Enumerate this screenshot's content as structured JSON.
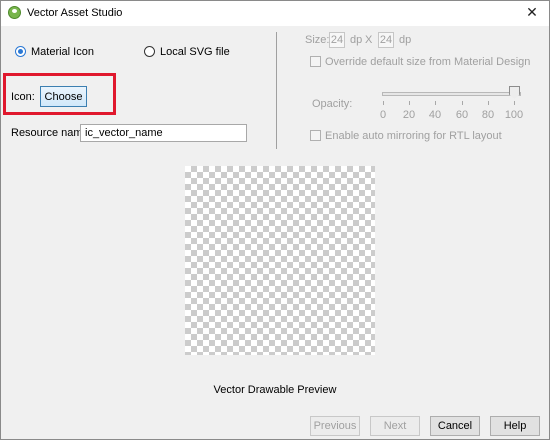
{
  "window": {
    "title": "Vector Asset Studio",
    "close_glyph": "✕",
    "app_icon": "android-studio-icon"
  },
  "source": {
    "material_icon_label": "Material Icon",
    "local_svg_label": "Local SVG file",
    "selected": "Material Icon"
  },
  "icon_row": {
    "label": "Icon:",
    "choose_label": "Choose"
  },
  "resource": {
    "label": "Resource name:",
    "value": "ic_vector_name"
  },
  "size": {
    "label": "Size:",
    "width": "24",
    "width_unit": "dp",
    "separator": "X",
    "height": "24",
    "height_unit": "dp"
  },
  "override": {
    "label": "Override default size from Material Design",
    "checked": false
  },
  "opacity": {
    "label": "Opacity:",
    "value": 100,
    "ticks": [
      "0",
      "20",
      "40",
      "60",
      "80",
      "100"
    ]
  },
  "mirroring": {
    "label": "Enable auto mirroring for RTL layout",
    "checked": false
  },
  "preview": {
    "caption": "Vector Drawable Preview"
  },
  "buttons": {
    "previous": "Previous",
    "next": "Next",
    "cancel": "Cancel",
    "help": "Help"
  },
  "colors": {
    "highlight": "#e0182d",
    "accent": "#2a78d4"
  }
}
